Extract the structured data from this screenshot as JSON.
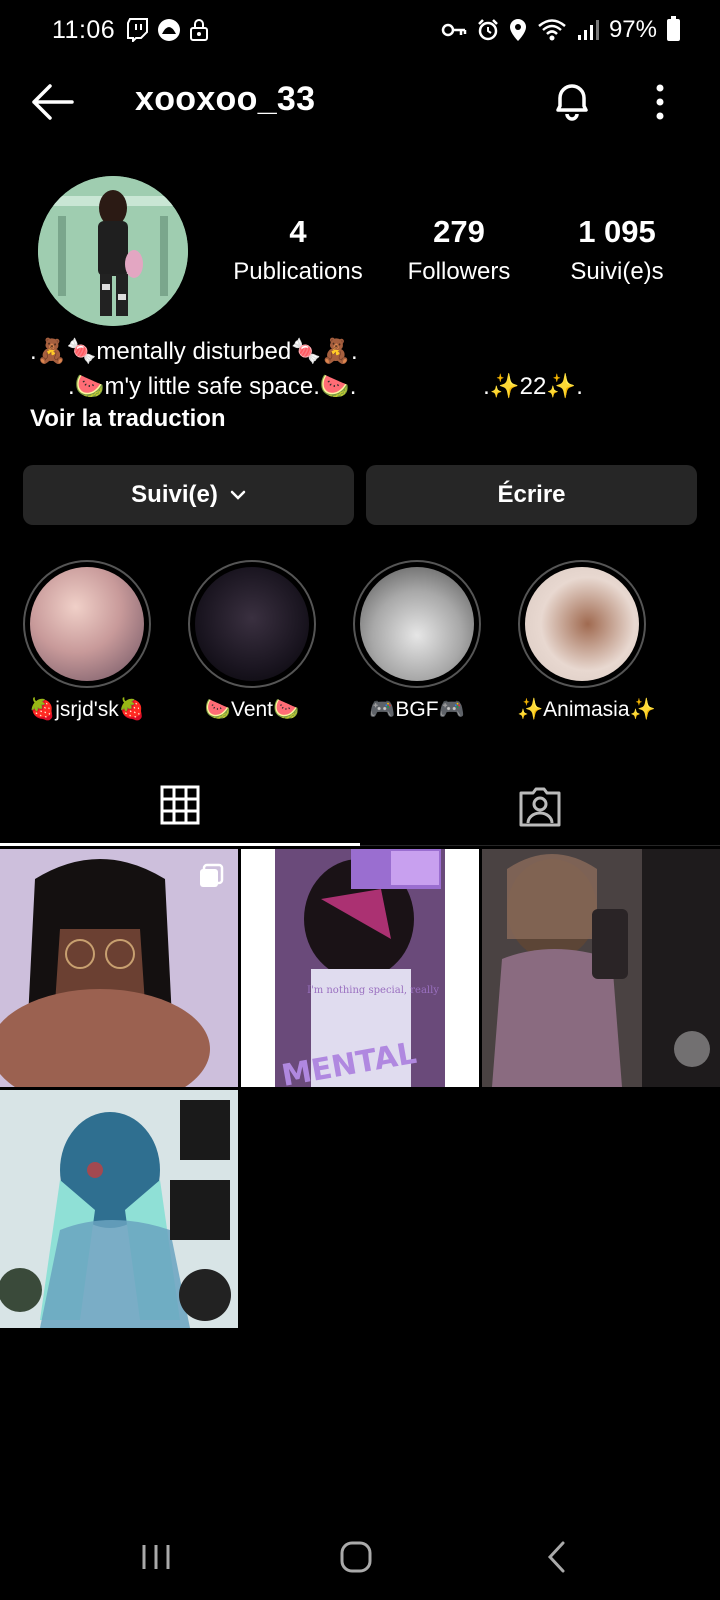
{
  "status_bar": {
    "time": "11:06",
    "battery": "97%"
  },
  "header": {
    "username": "xooxoo_33"
  },
  "profile": {
    "stats": {
      "posts_count": "4",
      "posts_label": "Publications",
      "followers_count": "279",
      "followers_label": "Followers",
      "following_count": "1 095",
      "following_label": "Suivi(e)s"
    },
    "bio_line1": ".🧸🍬mentally disturbed🍬🧸.",
    "bio_line2": ".🍉m'y little safe space.🍉.                   .✨22✨.",
    "translate_link": "Voir la traduction"
  },
  "actions": {
    "followed_label": "Suivi(e)",
    "message_label": "Écrire"
  },
  "highlights": [
    {
      "label": "🍓jsrjd'sk🍓",
      "colors": [
        "#e9c6c6",
        "#8a6a6a"
      ]
    },
    {
      "label": "🍉Vent🍉",
      "colors": [
        "#2a2430",
        "#0c0a10"
      ]
    },
    {
      "label": "🎮BGF🎮",
      "colors": [
        "#cfcfcf",
        "#6b6b6b"
      ]
    },
    {
      "label": "✨Animasia✨",
      "colors": [
        "#e8dcd6",
        "#5a3a30"
      ]
    }
  ],
  "post_texts": {
    "post2_caption": "I'm nothing special, really",
    "post2_overlay": "MENTAL"
  },
  "theme": {
    "background": "#000000",
    "button_bg": "#262626",
    "text": "#ffffff"
  }
}
